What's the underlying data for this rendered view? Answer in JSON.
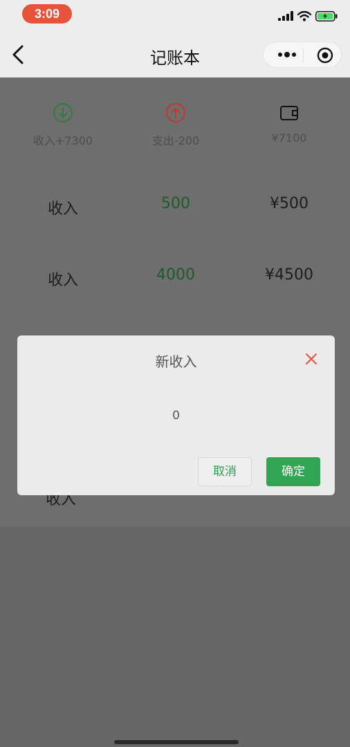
{
  "status_bar": {
    "time": "3:09"
  },
  "nav": {
    "title": "记账本"
  },
  "summary": {
    "income_label": "收入+7300",
    "expense_label": "支出-200",
    "balance_label": "¥7100"
  },
  "records": [
    {
      "type": "收入",
      "amount": "500",
      "total": "¥500"
    },
    {
      "type": "收入",
      "amount": "4000",
      "total": "¥4500"
    },
    {
      "type": "收入"
    }
  ],
  "modal": {
    "title": "新收入",
    "value": "0",
    "cancel_label": "取消",
    "confirm_label": "确定"
  },
  "colors": {
    "income_green": "#2e7d3a",
    "expense_red": "#c0392b",
    "confirm_button": "#31a554",
    "close_icon": "#e8513a",
    "time_pill": "#e8513a"
  },
  "icons": {
    "income": "arrow-down-circle-icon",
    "expense": "arrow-up-circle-icon",
    "balance": "wallet-icon",
    "close": "close-icon"
  }
}
